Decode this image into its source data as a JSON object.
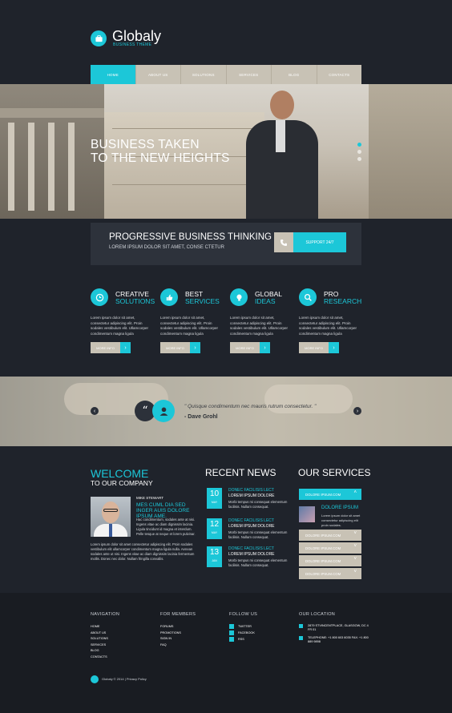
{
  "brand": {
    "name": "Globaly",
    "tagline": "BUSINESS THEME"
  },
  "nav": [
    "HOME",
    "ABOUT US",
    "SOLUTIONS",
    "SERVICES",
    "BLOG",
    "CONTACTS"
  ],
  "hero": {
    "line1": "BUSINESS TAKEN",
    "line2": "TO THE NEW HEIGHTS",
    "slides": 3,
    "active_slide": 1
  },
  "progressive": {
    "title": "PROGRESSIVE BUSINESS THINKING",
    "subtitle": "LOREM IPSUM DOLOR SIT AMET, CONSE CTETUR",
    "button": "SUPPORT 24/7"
  },
  "features": [
    {
      "icon": "clock-icon",
      "t1": "CREATIVE",
      "t2": "SOLUTIONS",
      "text": "Lorem ipsum dolor sit amet, consectetur adipiscing elit. Proin sodales vestibulum elit. Ullamcorper condimentum magna ligula",
      "button": "MORE INFO"
    },
    {
      "icon": "thumbs-up-icon",
      "t1": "BEST",
      "t2": "SERVICES",
      "text": "Lorem ipsum dolor sit amet, consectetur adipiscing elit. Proin sodales vestibulum elit. Ullamcorper condimentum magna ligula",
      "button": "MORE INFO"
    },
    {
      "icon": "lightbulb-icon",
      "t1": "GLOBAL",
      "t2": "IDEAS",
      "text": "Lorem ipsum dolor sit amet, consectetur adipiscing elit. Proin sodales vestibulum elit. Ullamcorper condimentum magna ligula",
      "button": "MORE INFO"
    },
    {
      "icon": "search-icon",
      "t1": "PRO",
      "t2": "RESEARCH",
      "text": "Lorem ipsum dolor sit amet, consectetur adipiscing elit. Proin sodales vestibulum elit. Ullamcorper condimentum magna ligula",
      "button": "MORE INFO"
    }
  ],
  "testimonial": {
    "quote": "\" Quisque condimentum nec mauris rutrum consectetur. \"",
    "author": "- Dave Grohl"
  },
  "welcome": {
    "t1": "WELCOME",
    "t2": "TO OUR COMPANY",
    "name": "MIKE STEWART",
    "sub": "MES CUML DIA SED INGER AUIS DOLORE IPSUM AME.",
    "body": "Hac condimentum, sodales ante at nisi. Ingens vitae ac diam dignissim lacinia. Ligula tincidunt id magna et interdum. Pelle tesque at neque et lorem pulvinar.",
    "body2": "Lorem ipsum dolor sit amet consectetur adipiscing elit. Proin sodales vestibulum elit ullamcorper condimentum magna ligula nulla. Aenean sodales ante ut nisi. Ingens vitae ac diam dignissim lacinia fermentum mollis. Donec nec dolor. Nullam fringilla convallis."
  },
  "news": {
    "title": "RECENT NEWS",
    "items": [
      {
        "day": "10",
        "month": "MAY",
        "h1": "DONEC FACILISIS LECT",
        "h2": "LOREM IPSUM DOLORE",
        "body": "Morbi tempus mi consequat elementum facilisis. Nullam consequat."
      },
      {
        "day": "12",
        "month": "MAY",
        "h1": "DONEC FACILISIS LECT",
        "h2": "LOREM IPSUM DOLORE",
        "body": "Morbi tempus mi consequat elementum facilisis. Nullam consequat."
      },
      {
        "day": "13",
        "month": "JAN",
        "h1": "DONEC FACILISIS LECT",
        "h2": "LOREM IPSUM DOLORE",
        "body": "Morbi tempus mi consequat elementum facilisis. Nullam consequat."
      }
    ]
  },
  "services": {
    "title": "OUR SERVICES",
    "open": "DOLORE IPSUM.COM",
    "detail_h": "DOLORE IPSUM",
    "detail_b": "Lorem ipsum dolor sit amet consectetur adipiscing elit proin sodales.",
    "items": [
      "DOLORE IPSUM.COM",
      "DOLORE IPSUM.COM",
      "DOLORE IPSUM.COM",
      "DOLORE IPSUM.COM"
    ]
  },
  "footer": {
    "nav_h": "NAVIGATION",
    "nav": [
      "HOME",
      "ABOUT US",
      "SOLUTIONS",
      "SERVICES",
      "BLOG",
      "CONTACTS"
    ],
    "mem_h": "FOR MEMBERS",
    "mem": [
      "FORUMS",
      "PROMOTIONS",
      "SIGN IN",
      "FAQ"
    ],
    "fol_h": "FOLLOW US",
    "fol": [
      "TWITTER",
      "FACEBOOK",
      "RSS"
    ],
    "loc_h": "OUR LOCATION",
    "addr": "2879 STVINCENTPLACE, GLASGOW, DC 4 FR 01",
    "phone": "TELEPHONE: +1 800 603 6035 FAX: +1 800 889 9898",
    "copy": "Globaly © 2014 | Privacy Policy"
  },
  "colors": {
    "accent": "#1cc7d8",
    "bg": "#1f232b",
    "beige": "#c8c2b5"
  }
}
